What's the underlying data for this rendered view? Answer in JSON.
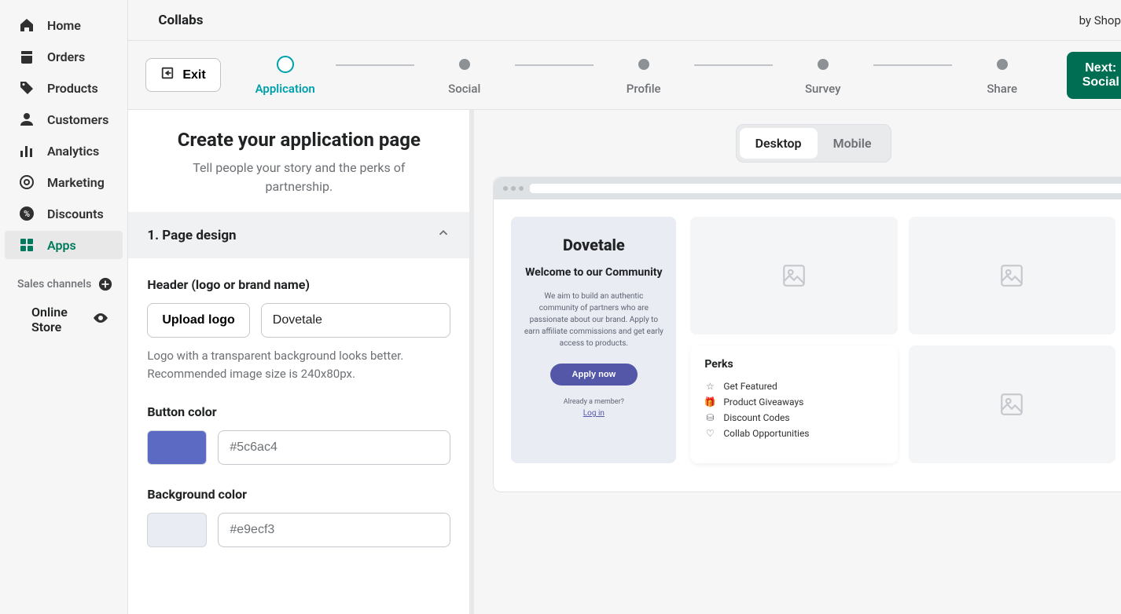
{
  "sidebar": {
    "items": [
      {
        "label": "Home"
      },
      {
        "label": "Orders"
      },
      {
        "label": "Products"
      },
      {
        "label": "Customers"
      },
      {
        "label": "Analytics"
      },
      {
        "label": "Marketing"
      },
      {
        "label": "Discounts"
      },
      {
        "label": "Apps"
      }
    ],
    "channels_label": "Sales channels",
    "online_store": "Online Store"
  },
  "topbar": {
    "title": "Collabs",
    "by": "by Shopify"
  },
  "wizard": {
    "exit": "Exit",
    "steps": [
      "Application",
      "Social",
      "Profile",
      "Survey",
      "Share"
    ],
    "next": "Next: Social"
  },
  "editor": {
    "title": "Create your application page",
    "subtitle": "Tell people your story and the perks of partnership.",
    "section1": "1. Page design",
    "header_label": "Header (logo or brand name)",
    "upload_label": "Upload logo",
    "brand_name": "Dovetale",
    "logo_help": "Logo with a transparent background looks better. Recommended image size is 240x80px.",
    "button_color_label": "Button color",
    "button_color_value": "#5c6ac4",
    "bg_color_label": "Background color",
    "bg_color_value": "#e9ecf3"
  },
  "preview": {
    "device_desktop": "Desktop",
    "device_mobile": "Mobile",
    "hero_title": "Dovetale",
    "hero_subtitle": "Welcome to our Community",
    "hero_body": "We aim to build an authentic community of partners who are passionate about our brand. Apply to earn affiliate commissions and get early access to products.",
    "apply": "Apply now",
    "member_q": "Already a member?",
    "login": "Log in",
    "perks_title": "Perks",
    "perks": [
      "Get Featured",
      "Product Giveaways",
      "Discount Codes",
      "Collab Opportunities"
    ]
  },
  "colors": {
    "button_swatch": "#5c6ac4",
    "bg_swatch": "#e9ecf3"
  }
}
